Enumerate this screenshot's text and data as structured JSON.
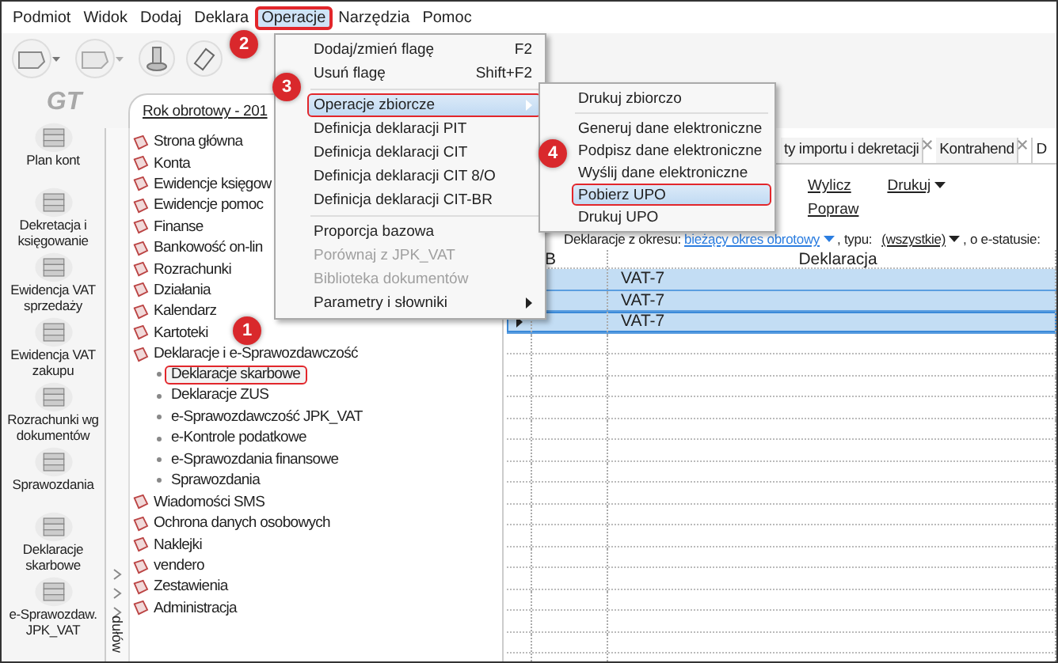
{
  "menu_bar": [
    {
      "label": "Podmiot",
      "selected": false,
      "annotated": false
    },
    {
      "label": "Widok",
      "selected": false,
      "annotated": false
    },
    {
      "label": "Dodaj",
      "selected": false,
      "annotated": false
    },
    {
      "label": "Deklara",
      "selected": false,
      "annotated": false
    },
    {
      "label": "Operacje",
      "selected": true,
      "annotated": true
    },
    {
      "label": "Narzędzia",
      "selected": false,
      "annotated": false
    },
    {
      "label": "Pomoc",
      "selected": false,
      "annotated": false
    }
  ],
  "logo": "GT",
  "sidebar": [
    {
      "label": "Plan kont"
    },
    {
      "label": "Dekretacja i księgowanie"
    },
    {
      "label": "Ewidencja VAT sprzedaży"
    },
    {
      "label": "Ewidencja VAT zakupu"
    },
    {
      "label": "Rozrachunki wg dokumentów"
    },
    {
      "label": "Sprawozdania"
    },
    {
      "label": "Deklaracje skarbowe"
    },
    {
      "label": "e-Sprawozdaw. JPK_VAT"
    }
  ],
  "period_tab": "Rok obrotowy - 201",
  "modules_strip": "dułów",
  "tree": [
    {
      "label": "Strona główna"
    },
    {
      "label": "Konta"
    },
    {
      "label": "Ewidencje księgow"
    },
    {
      "label": "Ewidencje pomoc"
    },
    {
      "label": "Finanse"
    },
    {
      "label": "Bankowość on-lin"
    },
    {
      "label": "Rozrachunki"
    },
    {
      "label": "Działania"
    },
    {
      "label": "Kalendarz"
    },
    {
      "label": "Kartoteki"
    },
    {
      "label": "Deklaracje i e-Sprawozdawczość",
      "children": [
        {
          "label": "Deklaracje skarbowe",
          "selected": true,
          "annotated": true
        },
        {
          "label": "Deklaracje ZUS",
          "selected": false,
          "annotated": false
        },
        {
          "label": "e-Sprawozdawczość JPK_VAT",
          "selected": false,
          "annotated": false
        },
        {
          "label": "e-Kontrole podatkowe",
          "selected": false,
          "annotated": false
        },
        {
          "label": "e-Sprawozdania finansowe",
          "selected": false,
          "annotated": false
        },
        {
          "label": "Sprawozdania",
          "selected": false,
          "annotated": false
        }
      ]
    },
    {
      "label": "Wiadomości SMS"
    },
    {
      "label": "Ochrona danych osobowych"
    },
    {
      "label": "Naklejki"
    },
    {
      "label": "vendero"
    },
    {
      "label": "Zestawienia"
    },
    {
      "label": "Administracja"
    }
  ],
  "tabs": [
    {
      "label": "ty importu i dekretacji",
      "selected": false
    },
    {
      "label": "Kontrahend",
      "selected": false
    },
    {
      "label": "D",
      "selected": true
    }
  ],
  "actions": [
    {
      "label": "Wylicz",
      "dropdown": false
    },
    {
      "label": "Popraw",
      "dropdown": false
    },
    {
      "label": "Drukuj",
      "dropdown": true
    }
  ],
  "filter": {
    "label": "Deklaracje z okresu:",
    "period": "bieżący okres obrotowy",
    "type_label": ", typu:",
    "type": "(wszystkie)",
    "status_label": ", o e-statusie:"
  },
  "grid": {
    "columns": [
      "B",
      "Deklaracja"
    ],
    "rows": [
      {
        "declaration": "VAT-7",
        "selected": true,
        "current": false
      },
      {
        "declaration": "VAT-7",
        "selected": true,
        "current": false
      },
      {
        "declaration": "VAT-7",
        "selected": true,
        "current": true
      }
    ]
  },
  "operations_menu": [
    {
      "kind": "item",
      "label": "Dodaj/zmień flagę",
      "shortcut": "F2",
      "selected": false,
      "disabled": false,
      "annotated": false
    },
    {
      "kind": "item",
      "label": "Usuń flagę",
      "shortcut": "Shift+F2",
      "selected": false,
      "disabled": false,
      "annotated": false
    },
    {
      "kind": "separator"
    },
    {
      "kind": "submenu",
      "label": "Operacje zbiorcze",
      "selected": true,
      "disabled": false,
      "annotated": true
    },
    {
      "kind": "item",
      "label": "Definicja deklaracji PIT",
      "selected": false,
      "disabled": false,
      "annotated": false
    },
    {
      "kind": "item",
      "label": "Definicja deklaracji CIT",
      "selected": false,
      "disabled": false,
      "annotated": false
    },
    {
      "kind": "item",
      "label": "Definicja deklaracji CIT 8/O",
      "selected": false,
      "disabled": false,
      "annotated": false
    },
    {
      "kind": "item",
      "label": "Definicja deklaracji CIT-BR",
      "selected": false,
      "disabled": false,
      "annotated": false
    },
    {
      "kind": "separator"
    },
    {
      "kind": "item",
      "label": "Proporcja bazowa",
      "selected": false,
      "disabled": false,
      "annotated": false
    },
    {
      "kind": "item",
      "label": "Porównaj z JPK_VAT",
      "selected": false,
      "disabled": true,
      "annotated": false
    },
    {
      "kind": "item",
      "label": "Biblioteka dokumentów",
      "selected": false,
      "disabled": true,
      "annotated": false
    },
    {
      "kind": "submenu",
      "label": "Parametry i słowniki",
      "selected": false,
      "disabled": false,
      "annotated": false
    }
  ],
  "submenu": [
    {
      "kind": "item",
      "label": "Drukuj zbiorczo",
      "selected": false,
      "disabled": false,
      "annotated": false
    },
    {
      "kind": "separator"
    },
    {
      "kind": "item",
      "label": "Generuj dane elektroniczne",
      "selected": false,
      "disabled": false,
      "annotated": false
    },
    {
      "kind": "item",
      "label": "Podpisz dane elektroniczne",
      "selected": false,
      "disabled": false,
      "annotated": false
    },
    {
      "kind": "item",
      "label": "Wyślij dane elektroniczne",
      "selected": false,
      "disabled": false,
      "annotated": false
    },
    {
      "kind": "item",
      "label": "Pobierz UPO",
      "selected": true,
      "disabled": false,
      "annotated": true
    },
    {
      "kind": "item",
      "label": "Drukuj UPO",
      "selected": false,
      "disabled": false,
      "annotated": false
    }
  ],
  "callouts": [
    {
      "number": "1"
    },
    {
      "number": "2"
    },
    {
      "number": "3"
    },
    {
      "number": "4"
    }
  ]
}
